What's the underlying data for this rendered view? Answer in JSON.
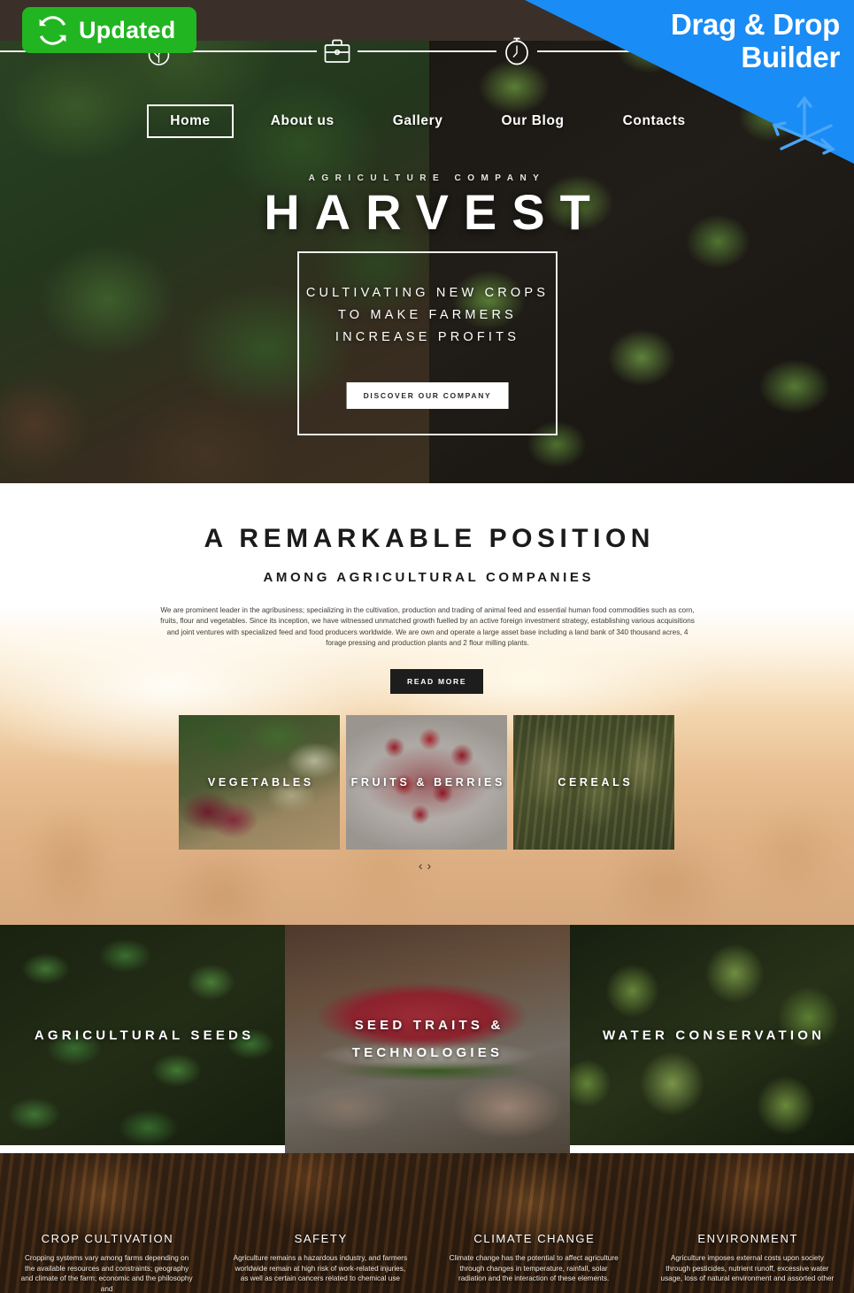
{
  "badge": {
    "label": "Updated",
    "icon": "refresh-icon",
    "color": "#22b522"
  },
  "ribbon": {
    "line1": "Drag & Drop",
    "line2": "Builder",
    "icon": "drag-arrows-icon",
    "color": "#1a8cf5"
  },
  "nav": {
    "items": [
      {
        "label": "Home",
        "active": true
      },
      {
        "label": "About us",
        "active": false
      },
      {
        "label": "Gallery",
        "active": false
      },
      {
        "label": "Our Blog",
        "active": false
      },
      {
        "label": "Contacts",
        "active": false
      }
    ]
  },
  "hero": {
    "eyebrow": "AGRICULTURE COMPANY",
    "title": "HARVEST",
    "tagline": "CULTIVATING NEW CROPS TO MAKE FARMERS INCREASE PROFITS",
    "button": "DISCOVER OUR COMPANY"
  },
  "intro": {
    "title": "A REMARKABLE POSITION",
    "subtitle": "AMONG AGRICULTURAL COMPANIES",
    "body": "We are prominent leader in the agribusiness; specializing in the cultivation, production and trading of animal feed and essential human food commodities such as corn, fruits, flour  and vegetables. Since its inception, we have witnessed unmatched growth fuelled by an active foreign investment strategy, establishing various acquisitions and joint ventures with specialized feed and food producers worldwide. We are own and operate a large asset base including a land bank of 340 thousand acres, 4 forage pressing and production plants and 2 flour milling plants.",
    "button": "READ MORE"
  },
  "categories": {
    "items": [
      {
        "caption": "VEGETABLES",
        "image": "vegetables-photo"
      },
      {
        "caption": "FRUITS & BERRIES",
        "image": "raspberries-photo"
      },
      {
        "caption": "CEREALS",
        "image": "wheat-ears-photo"
      }
    ],
    "prev": "‹",
    "next": "›"
  },
  "panels": {
    "items": [
      {
        "caption": "AGRICULTURAL SEEDS",
        "image": "lettuce-seedlings-photo"
      },
      {
        "caption": "SEED TRAITS & TECHNOLOGIES",
        "image": "watermelon-slice-photo"
      },
      {
        "caption": "WATER CONSERVATION",
        "image": "wet-green-apples-photo"
      }
    ]
  },
  "services": {
    "items": [
      {
        "icon": "leaf-icon",
        "label": "CROP CULTIVATION",
        "desc": "Cropping systems vary among farms depending on the available resources and constraints; geography and climate of the farm; economic and the philosophy and"
      },
      {
        "icon": "briefcase-icon",
        "label": "SAFETY",
        "desc": "Agriculture remains a hazardous industry, and farmers worldwide remain at high risk of work-related injuries, as well as certain cancers related to chemical use"
      },
      {
        "icon": "stopwatch-icon",
        "label": "CLIMATE CHANGE",
        "desc": "Climate change has the potential to affect agriculture through changes in temperature, rainfall, solar radiation and the interaction of these elements."
      },
      {
        "icon": "sun-icon",
        "label": "ENVIRONMENT",
        "desc": "Agriculture imposes external costs upon society through pesticides, nutrient runoff, excessive water usage, loss of natural environment and assorted other"
      }
    ]
  }
}
